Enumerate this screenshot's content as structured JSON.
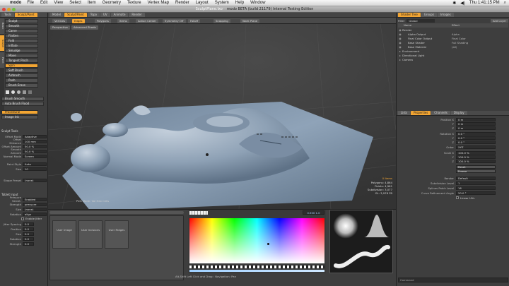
{
  "menubar": {
    "app": "modo",
    "items": [
      "File",
      "Edit",
      "View",
      "Select",
      "Item",
      "Geometry",
      "Texture",
      "Vertex Map",
      "Render",
      "Layout",
      "System",
      "Help",
      "Window"
    ],
    "time": "Thu 1:41:15 PM"
  },
  "window": {
    "file_title": "SculptPlane.lxo",
    "title": "modo BETA (build 21179) Internal Testing Edition"
  },
  "left_tabs": [
    "Tools",
    "Sculpt/Paint"
  ],
  "left_vtabs": [
    "Basic",
    "Sculpt",
    "Paint"
  ],
  "sculpt_tools": [
    "Sculpt",
    "Smooth",
    "Carve",
    "Flatten",
    "Fold",
    "Inflate",
    "Smudge",
    "Move",
    "Tangent Pinch",
    "Spin",
    "Soft Brush",
    "Airbrush",
    "Push",
    "Brush Erase"
  ],
  "selected_tool": "Spin",
  "brush_buttons": [
    "Brush Smooth",
    "Auto Brush Flood"
  ],
  "image_buttons": [
    "Procedural",
    "Image Ink"
  ],
  "tool_props": {
    "header": "Sculpt Tools",
    "rows": [
      {
        "label": "Offset Mode",
        "value": "Adaptive"
      },
      {
        "label": "Offset Distance",
        "value": "100 mm"
      },
      {
        "label": "Offset Amount",
        "value": "50.0 %"
      },
      {
        "label": "Smooth Amount",
        "value": "50.0 %"
      },
      {
        "label": "Normal Mode",
        "value": "Screen"
      },
      {
        "label": "Paint Style",
        "value": "Auto"
      },
      {
        "label": "Size",
        "value": "10"
      },
      {
        "label": "Shape Preset",
        "value": "(none)"
      }
    ],
    "section2": "Tablet Input",
    "rows2": [
      {
        "label": "Pressure Sensit.",
        "value": "Enabled"
      },
      {
        "label": "Strength",
        "value": "pressure"
      },
      {
        "label": "Size",
        "value": "(none)"
      },
      {
        "label": "Rotation",
        "value": "align"
      }
    ],
    "enable_jitter": "Enable Jitter",
    "jitter": [
      {
        "label": "Jitter Spacing",
        "value": "0.0"
      },
      {
        "label": "Position",
        "value": "0.0"
      },
      {
        "label": "Size",
        "value": "0.0"
      },
      {
        "label": "Rotation",
        "value": "0.0"
      },
      {
        "label": "Strength",
        "value": "0.0"
      }
    ]
  },
  "viewport_tabs": [
    "Model",
    "Sculpt/Paint",
    "Topo",
    "UV",
    "Animate",
    "Render"
  ],
  "viewport_toolbar": {
    "buttons": [
      "Vertices",
      "Edges",
      "Polygons",
      "Items",
      "Action Center",
      "Symmetry Off",
      "Falloff",
      "Snapping",
      "Work Plane"
    ],
    "active": "Edges",
    "view_mode": "Perspective",
    "shading": "Advanced Shade"
  },
  "viewport_info": {
    "hud": "Pxls Mode: Vol Hex Cells",
    "stats": [
      "Polygons: 4,864",
      "Points: 4,961",
      "Subdivision: 3,077",
      "GL: 3,978 FB"
    ],
    "selected_label": "0 Items"
  },
  "bottom": {
    "brush_presets": [
      "User Image",
      "User Incisions",
      "User Ridges"
    ],
    "color_value": "0.500 1.0",
    "status": "Alt-Shift Left Click and Drag : Navigation: Pan"
  },
  "right_tabs": [
    "Shader Tree",
    "Groups",
    "Images"
  ],
  "right_toolbar": {
    "filter": "Filter",
    "view": "Global",
    "add": "Add Layer"
  },
  "shader_tree": {
    "headers": [
      "Name",
      "Effect"
    ],
    "rows": [
      {
        "indent": 0,
        "name": "Render",
        "effect": ""
      },
      {
        "indent": 1,
        "name": "Alpha Output",
        "effect": "Alpha"
      },
      {
        "indent": 1,
        "name": "Final Color Output",
        "effect": "Final Color"
      },
      {
        "indent": 1,
        "name": "Base Shader",
        "effect": "Full Shading"
      },
      {
        "indent": 1,
        "name": "Base Material",
        "effect": "(all)"
      },
      {
        "indent": 0,
        "name": "Environment",
        "effect": ""
      },
      {
        "indent": 0,
        "name": "Directional Light",
        "effect": ""
      },
      {
        "indent": 0,
        "name": "Camera",
        "effect": ""
      }
    ]
  },
  "prop_tabs": [
    "Lists",
    "Properties",
    "Channels",
    "Display"
  ],
  "properties": {
    "rows": [
      {
        "label": "Position X",
        "value": "0 m"
      },
      {
        "label": "Y",
        "value": "0 m"
      },
      {
        "label": "Z",
        "value": "0 m"
      },
      {
        "label": "Rotation X",
        "value": "0.0 °"
      },
      {
        "label": "Y",
        "value": "0.0 °"
      },
      {
        "label": "Z",
        "value": "0.0 °"
      },
      {
        "label": "Order",
        "value": "XYZ"
      },
      {
        "label": "Scale X",
        "value": "100.0 %"
      },
      {
        "label": "Y",
        "value": "100.0 %"
      },
      {
        "label": "Z",
        "value": "100.0 %"
      },
      {
        "label": "",
        "value": "Reset"
      },
      {
        "label": "",
        "value": "Freeze"
      },
      {
        "label": "Render",
        "value": "Default"
      },
      {
        "label": "Subdivision Level",
        "value": "1"
      },
      {
        "label": "Splines Patch Level",
        "value": "16"
      },
      {
        "label": "Curve Refinement Angle",
        "value": "20.0 °"
      },
      {
        "label": "",
        "value": "Linear UVs"
      }
    ]
  },
  "command": "Command"
}
